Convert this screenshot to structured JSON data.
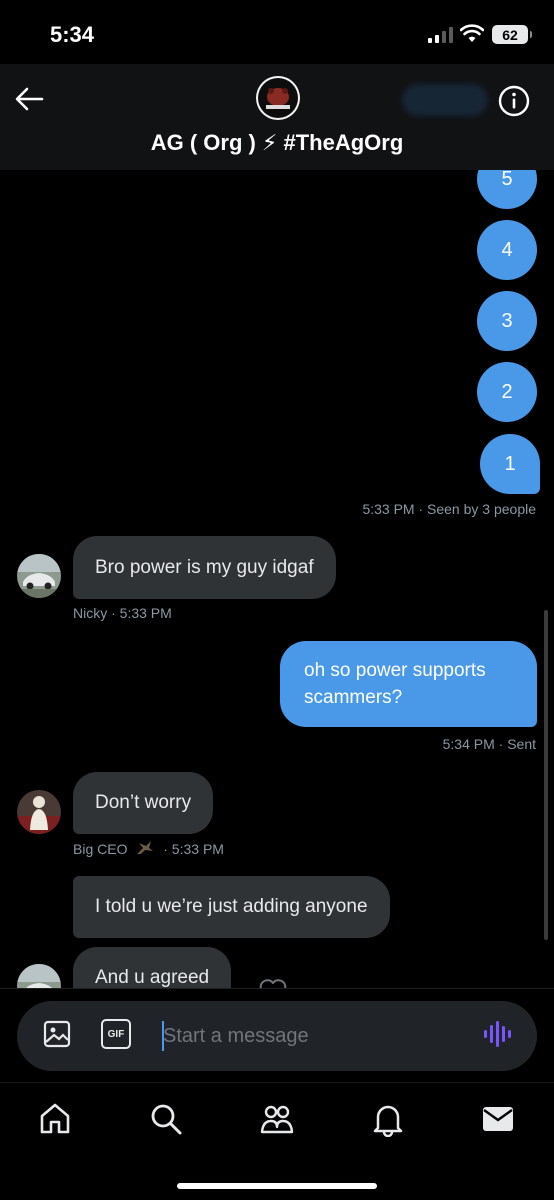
{
  "status_bar": {
    "time": "5:34",
    "battery": "62"
  },
  "header": {
    "title": "AG ( Org ) ⚡ #TheAgOrg",
    "avatar_icon": "group-avatar-icon",
    "back_icon": "arrow-left-icon",
    "info_icon": "info-icon"
  },
  "messages": {
    "numbers": [
      "5",
      "4",
      "3",
      "2",
      "1"
    ],
    "numbers_meta": "5:33 PM · Seen by 3 people",
    "nicky": {
      "text": "Bro power is my guy idgaf",
      "meta": "Nicky · 5:33 PM"
    },
    "mine": {
      "text": "oh so power supports scammers?",
      "meta": "5:34 PM · Sent"
    },
    "bigceo": {
      "text1": "Don’t worry",
      "sender": "Big CEO",
      "time": "· 5:33 PM",
      "text2": "I told u we’re just adding anyone",
      "text3": "And u agreed"
    }
  },
  "composer": {
    "placeholder": "Start a message",
    "gif_label": "GIF"
  },
  "tabs": [
    "home-icon",
    "search-icon",
    "communities-icon",
    "notifications-icon",
    "messages-icon"
  ],
  "colors": {
    "accent": "#4a99e9",
    "bubble_in": "#2f3336",
    "voice": "#7856ff"
  }
}
